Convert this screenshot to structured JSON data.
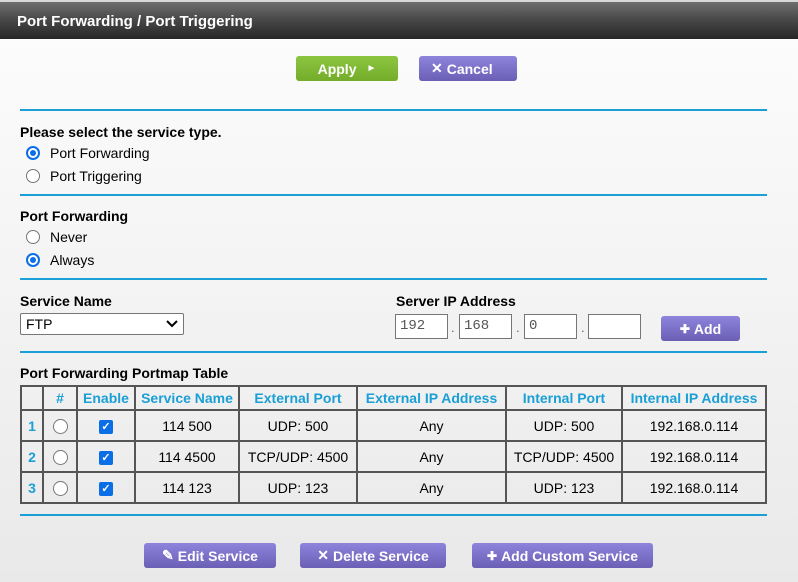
{
  "header": {
    "title": "Port Forwarding / Port Triggering"
  },
  "toolbar": {
    "apply_label": "Apply",
    "apply_icon": "►",
    "cancel_label": "Cancel",
    "cancel_icon": "✕"
  },
  "service_type": {
    "label": "Please select the service type.",
    "options": [
      {
        "label": "Port Forwarding",
        "checked": true
      },
      {
        "label": "Port Triggering",
        "checked": false
      }
    ]
  },
  "port_forwarding": {
    "label": "Port Forwarding",
    "options": [
      {
        "label": "Never",
        "checked": false
      },
      {
        "label": "Always",
        "checked": true
      }
    ]
  },
  "service_name": {
    "label": "Service Name",
    "selected": "FTP"
  },
  "server_ip": {
    "label": "Server IP Address",
    "octets": [
      "192",
      "168",
      "0",
      ""
    ],
    "dot": ".",
    "add_label": "Add",
    "add_icon": "✚"
  },
  "portmap_table": {
    "title": "Port Forwarding Portmap Table",
    "columns": [
      "",
      "#",
      "Enable",
      "Service Name",
      "External Port",
      "External IP Address",
      "Internal Port",
      "Internal IP Address"
    ],
    "rows": [
      {
        "index": "1",
        "enabled": true,
        "service_name": "114 500",
        "external_port": "UDP: 500",
        "external_ip": "Any",
        "internal_port": "UDP: 500",
        "internal_ip": "192.168.0.114"
      },
      {
        "index": "2",
        "enabled": true,
        "service_name": "114 4500",
        "external_port": "TCP/UDP: 4500",
        "external_ip": "Any",
        "internal_port": "TCP/UDP: 4500",
        "internal_ip": "192.168.0.114"
      },
      {
        "index": "3",
        "enabled": true,
        "service_name": "114 123",
        "external_port": "UDP: 123",
        "external_ip": "Any",
        "internal_port": "UDP: 123",
        "internal_ip": "192.168.0.114"
      }
    ]
  },
  "actions": {
    "edit_label": "Edit Service",
    "edit_icon": "✎",
    "delete_label": "Delete Service",
    "delete_icon": "✕",
    "add_custom_label": "Add Custom Service",
    "add_custom_icon": "✚"
  }
}
